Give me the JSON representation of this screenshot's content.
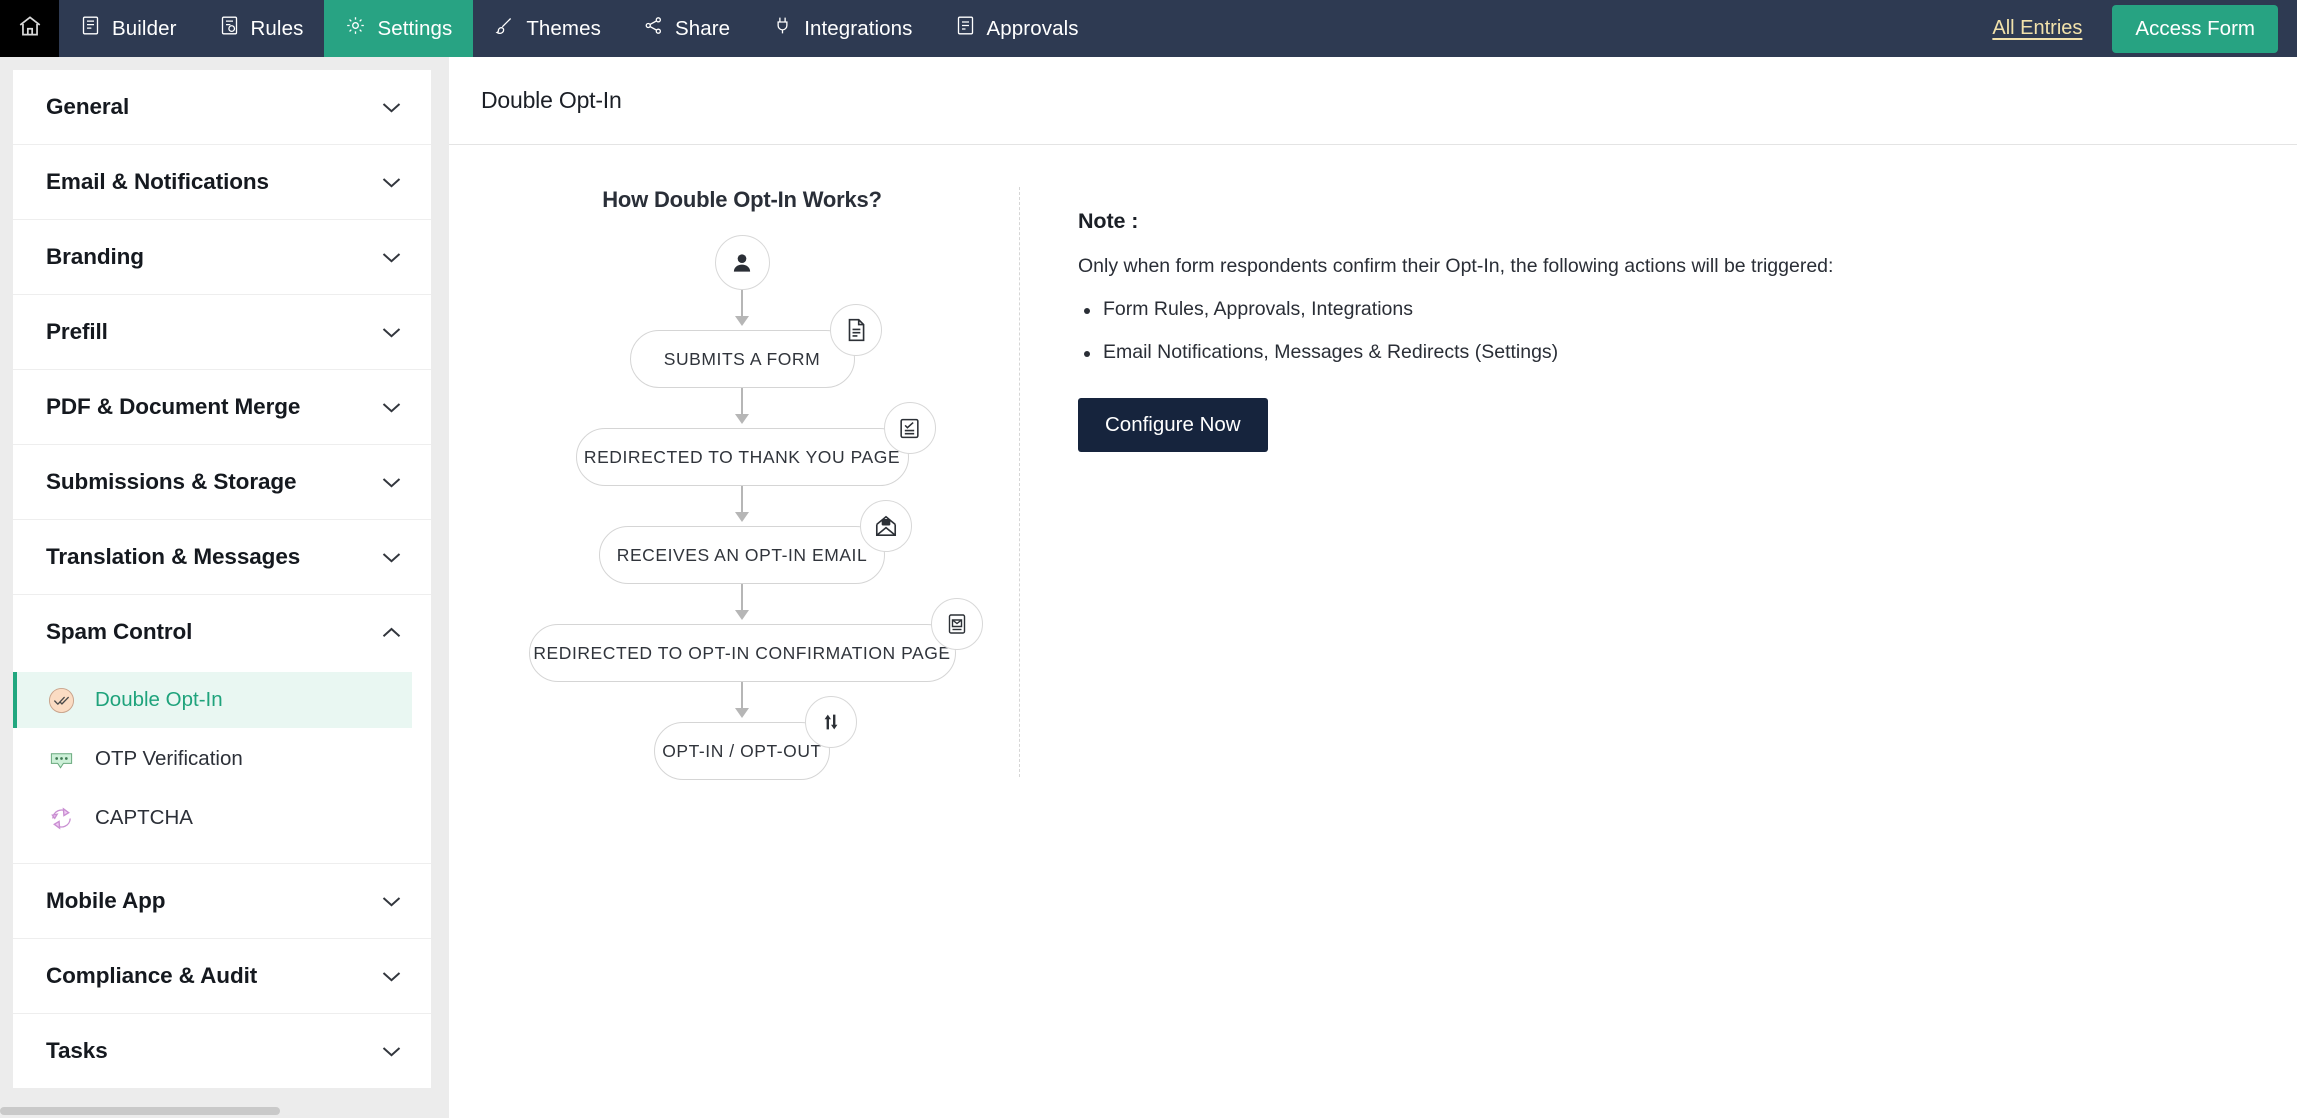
{
  "topnav": {
    "home_icon": "home-icon",
    "items": [
      {
        "label": "Builder",
        "icon": "form-builder-icon",
        "active": false
      },
      {
        "label": "Rules",
        "icon": "rules-icon",
        "active": false
      },
      {
        "label": "Settings",
        "icon": "gear-icon",
        "active": true
      },
      {
        "label": "Themes",
        "icon": "brush-icon",
        "active": false
      },
      {
        "label": "Share",
        "icon": "share-icon",
        "active": false
      },
      {
        "label": "Integrations",
        "icon": "integrations-icon",
        "active": false
      },
      {
        "label": "Approvals",
        "icon": "approvals-icon",
        "active": false
      }
    ],
    "all_entries_label": "All Entries",
    "access_form_label": "Access Form",
    "colors": {
      "bar_background": "#2e3a52",
      "active_tab": "#28a383",
      "accent_button": "#27a382",
      "link": "#f2e2ab",
      "home_background": "#000000"
    }
  },
  "sidebar": {
    "sections": [
      {
        "label": "General",
        "expanded": false
      },
      {
        "label": "Email & Notifications",
        "expanded": false
      },
      {
        "label": "Branding",
        "expanded": false
      },
      {
        "label": "Prefill",
        "expanded": false
      },
      {
        "label": "PDF & Document Merge",
        "expanded": false
      },
      {
        "label": "Submissions & Storage",
        "expanded": false
      },
      {
        "label": "Translation & Messages",
        "expanded": false
      },
      {
        "label": "Spam Control",
        "expanded": true
      },
      {
        "label": "Mobile App",
        "expanded": false
      },
      {
        "label": "Compliance & Audit",
        "expanded": false
      },
      {
        "label": "Tasks",
        "expanded": false
      }
    ],
    "spam_control_children": [
      {
        "label": "Double Opt-In",
        "icon": "double-check-circle-icon",
        "selected": true
      },
      {
        "label": "OTP Verification",
        "icon": "otp-chat-bubble-icon",
        "selected": false
      },
      {
        "label": "CAPTCHA",
        "icon": "captcha-refresh-icon",
        "selected": false
      }
    ],
    "selected_color": "#1fa37c",
    "selected_background": "#e9f7f2"
  },
  "page": {
    "title": "Double Opt-In"
  },
  "flow": {
    "title": "How Double Opt-In Works?",
    "start_icon": "user-avatar-icon",
    "steps": [
      {
        "label": "SUBMITS A FORM",
        "icon": "document-icon"
      },
      {
        "label": "REDIRECTED TO THANK YOU PAGE",
        "icon": "checklist-icon"
      },
      {
        "label": "RECEIVES AN OPT-IN EMAIL",
        "icon": "open-envelope-icon"
      },
      {
        "label": "REDIRECTED TO OPT-IN CONFIRMATION PAGE",
        "icon": "email-page-icon"
      },
      {
        "label": "OPT-IN / OPT-OUT",
        "icon": "up-down-arrows-icon"
      }
    ]
  },
  "note": {
    "title": "Note :",
    "subtitle": "Only when form respondents confirm their Opt-In, the following actions will be triggered:",
    "items": [
      "Form Rules, Approvals, Integrations",
      "Email Notifications, Messages & Redirects (Settings)"
    ],
    "button_label": "Configure Now",
    "button_color": "#16243d"
  }
}
